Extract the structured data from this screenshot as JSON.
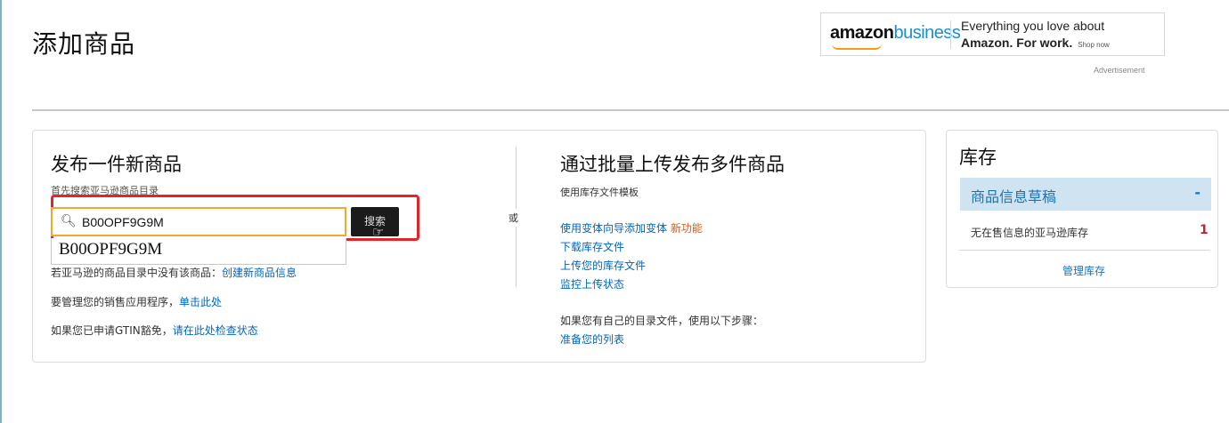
{
  "page": {
    "title": "添加商品"
  },
  "ad": {
    "logo_main": "amazon",
    "logo_sub": "business",
    "line1": "Everything you love about",
    "line2": "Amazon. For work.",
    "shop": "Shop now",
    "label": "Advertisement"
  },
  "single": {
    "title": "发布一件新商品",
    "hint": "首先搜索亚马逊商品目录",
    "search": {
      "value": "B00OPF9G9M",
      "button_label": "搜索"
    },
    "suggestion": "B00OPF9G9M",
    "line1_text": "若亚马逊的商品目录中没有该商品：",
    "line1_link": "创建新商品信息",
    "line2_text": "要管理您的销售应用程序，",
    "line2_link": "单击此处",
    "line3_text": "如果您已申请GTIN豁免，",
    "line3_link": "请在此处检查状态"
  },
  "or_label": "或",
  "bulk": {
    "title": "通过批量上传发布多件商品",
    "hint": "使用库存文件模板",
    "link1": "使用变体向导添加变体",
    "link1_badge": "新功能",
    "link2": "下载库存文件",
    "link3": "上传您的库存文件",
    "link4": "监控上传状态",
    "own_text": "如果您有自己的目录文件，使用以下步骤：",
    "own_link": "准备您的列表"
  },
  "inventory": {
    "title": "库存",
    "draft_label": "商品信息草稿",
    "draft_toggle": "-",
    "row_label": "无在售信息的亚马逊库存",
    "row_count": "1",
    "manage_link": "管理库存"
  },
  "colors": {
    "link": "#0066c0",
    "highlight_border": "#e0262b",
    "input_focus": "#f0a830",
    "new_badge": "#e25b0c",
    "draft_bg": "#cfe3f1"
  }
}
